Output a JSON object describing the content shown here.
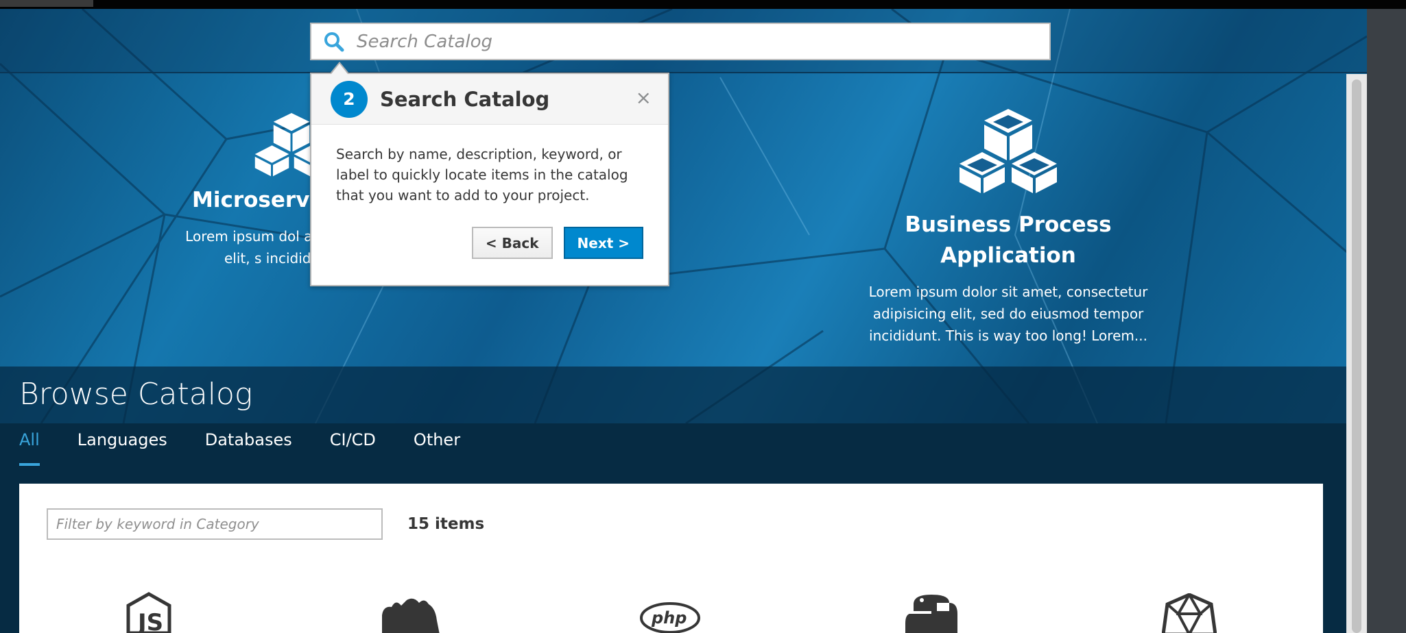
{
  "search": {
    "placeholder": "Search Catalog"
  },
  "features": [
    {
      "title": "Microservic",
      "description": "Lorem ipsum dol adipisicing elit, s incididunt."
    },
    {
      "title": "Business Process Application",
      "description": "Lorem ipsum dolor sit amet, consectetur adipisicing elit, sed do eiusmod tempor incididunt. This is way too long! Lorem..."
    }
  ],
  "tour": {
    "step": "2",
    "title": "Search Catalog",
    "close": "×",
    "body": "Search by name, description, keyword, or label to quickly locate items in the catalog that you want to add to your project.",
    "back_label": "< Back",
    "next_label": "Next >"
  },
  "browse": {
    "title": "Browse Catalog",
    "tabs": [
      {
        "label": "All"
      },
      {
        "label": "Languages"
      },
      {
        "label": "Databases"
      },
      {
        "label": "CI/CD"
      },
      {
        "label": "Other"
      }
    ],
    "filter_placeholder": "Filter by keyword in Category",
    "count": "15 items"
  },
  "tiles": [
    {
      "icon": "nodejs-icon"
    },
    {
      "icon": "perl-camel-icon"
    },
    {
      "icon": "php-icon"
    },
    {
      "icon": "python-icon"
    },
    {
      "icon": "ruby-icon"
    }
  ],
  "colors": {
    "accent": "#0088ce",
    "active_tab": "#39a5dc"
  }
}
